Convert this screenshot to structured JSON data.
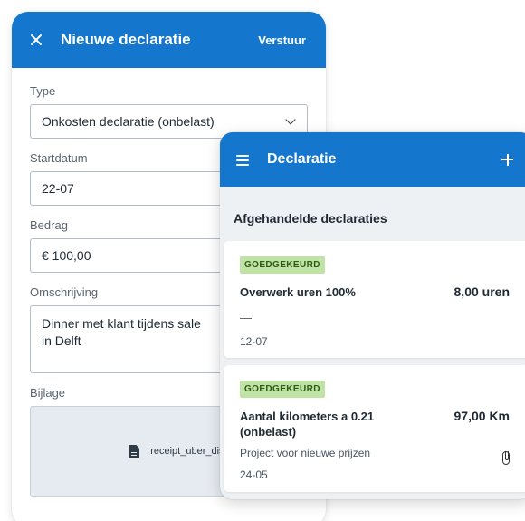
{
  "back_screen": {
    "header": {
      "title": "Nieuwe declaratie",
      "send_label": "Verstuur"
    },
    "fields": {
      "type_label": "Type",
      "type_value": "Onkosten declaratie (onbelast)",
      "start_label": "Startdatum",
      "start_value": "22-07",
      "amount_label": "Bedrag",
      "amount_value": "€ 100,00",
      "description_label": "Omschrijving",
      "description_value": "Dinner met klant tijdens sale\nin Delft",
      "attachment_label": "Bijlage",
      "attachment_file": "receipt_uber_dislocat"
    }
  },
  "front_screen": {
    "header": {
      "title": "Declaratie"
    },
    "section_title": "Afgehandelde declaraties",
    "cards": [
      {
        "status": "GOEDGEKEURD",
        "description": "Overwerk uren 100%",
        "amount": "8,00 uren",
        "note": "—",
        "date": "12-07"
      },
      {
        "status": "GOEDGEKEURD",
        "description": "Aantal kilometers a 0.21 (onbelast)",
        "amount": "97,00 Km",
        "project": "Project voor nieuwe prijzen",
        "date": "24-05"
      }
    ]
  },
  "colors": {
    "primary": "#1476cc",
    "badge_bg": "#bfe2a5",
    "badge_text": "#2e5a12"
  },
  "icons": [
    "close-icon",
    "chevron-down-icon",
    "file-icon",
    "menu-icon",
    "plus-icon",
    "paperclip-icon"
  ]
}
